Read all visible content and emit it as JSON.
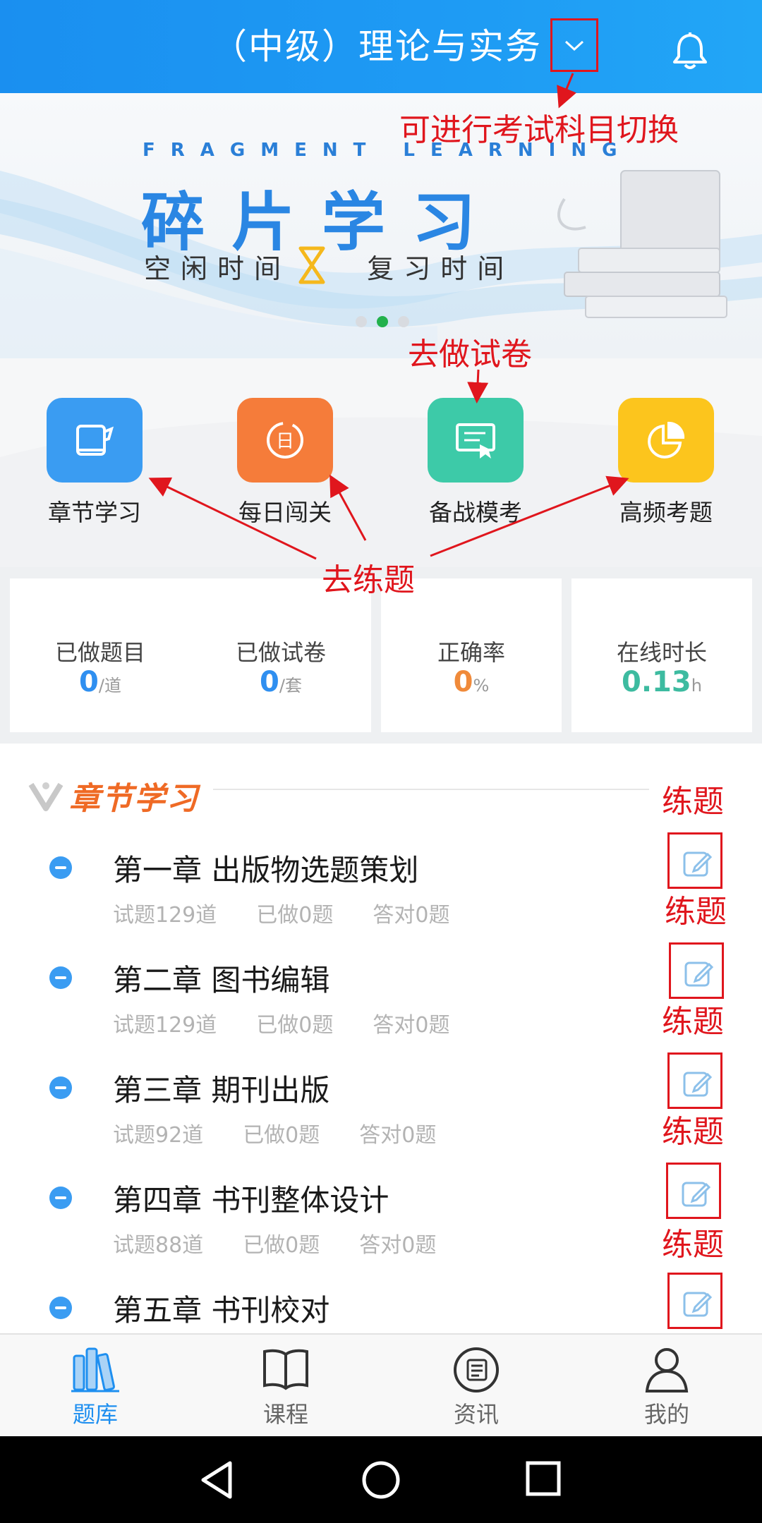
{
  "header": {
    "title": "（中级）理论与实务",
    "dropdown_icon": "chevron-down-icon",
    "bell_icon": "bell-icon"
  },
  "banner": {
    "tagline_en": "FRAGMENT  LEARNING",
    "title": "碎片学习",
    "subtitle_left": "空闲时间",
    "subtitle_right": "复习时间",
    "slides": 3,
    "active_slide": 2
  },
  "annotations": {
    "switch_subject": "可进行考试科目切换",
    "do_paper": "去做试卷",
    "do_practice": "去练题",
    "practice": "练题"
  },
  "quick_actions": [
    {
      "label": "章节学习",
      "icon": "book-icon",
      "color": "#3a9cf2"
    },
    {
      "label": "每日闯关",
      "icon": "calendar-day-icon",
      "color": "#f57c3a"
    },
    {
      "label": "备战模考",
      "icon": "exam-screen-icon",
      "color": "#3dcaa8"
    },
    {
      "label": "高频考题",
      "icon": "pie-chart-icon",
      "color": "#fcc51d"
    }
  ],
  "stats": [
    {
      "label": "已做题目",
      "value": "0",
      "unit": "/道",
      "color": "#2f8ff0"
    },
    {
      "label": "已做试卷",
      "value": "0",
      "unit": "/套",
      "color": "#2f8ff0"
    },
    {
      "label": "正确率",
      "value": "0",
      "unit": "%",
      "color": "#f08a3a"
    },
    {
      "label": "在线时长",
      "value": "0.13",
      "unit": "h",
      "color": "#3dbba0"
    }
  ],
  "section": {
    "title": "章节学习"
  },
  "chapters": [
    {
      "title": "第一章 出版物选题策划",
      "total": "试题129道",
      "done": "已做0题",
      "correct": "答对0题"
    },
    {
      "title": "第二章 图书编辑",
      "total": "试题129道",
      "done": "已做0题",
      "correct": "答对0题"
    },
    {
      "title": "第三章 期刊出版",
      "total": "试题92道",
      "done": "已做0题",
      "correct": "答对0题"
    },
    {
      "title": "第四章 书刊整体设计",
      "total": "试题88道",
      "done": "已做0题",
      "correct": "答对0题"
    },
    {
      "title": "第五章 书刊校对",
      "total": "",
      "done": "",
      "correct": ""
    }
  ],
  "tabs": [
    {
      "label": "题库",
      "icon": "books-icon",
      "active": true
    },
    {
      "label": "课程",
      "icon": "open-book-icon",
      "active": false
    },
    {
      "label": "资讯",
      "icon": "news-icon",
      "active": false
    },
    {
      "label": "我的",
      "icon": "user-icon",
      "active": false
    }
  ],
  "system_nav": [
    "back-icon",
    "home-icon",
    "recents-icon"
  ]
}
